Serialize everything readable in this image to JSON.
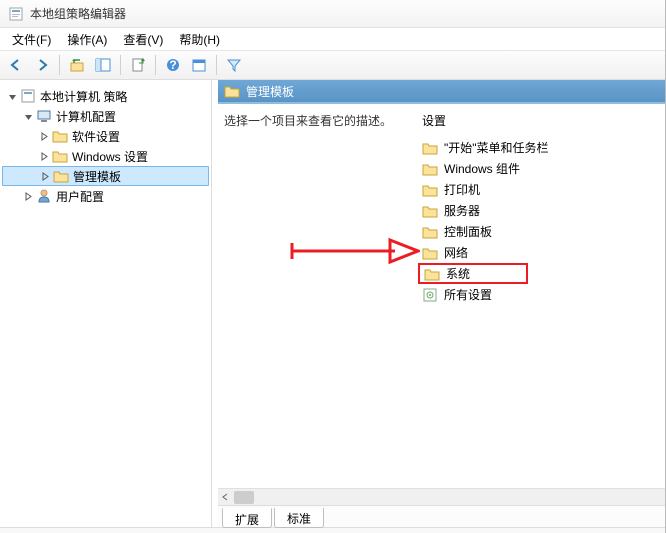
{
  "window": {
    "title": "本地组策略编辑器"
  },
  "menu": {
    "file": "文件(F)",
    "action": "操作(A)",
    "view": "查看(V)",
    "help": "帮助(H)"
  },
  "tree": {
    "root": "本地计算机 策略",
    "computer_config": "计算机配置",
    "software_settings": "软件设置",
    "windows_settings": "Windows 设置",
    "admin_templates": "管理模板",
    "user_config": "用户配置"
  },
  "right": {
    "header": "管理模板",
    "description": "选择一个项目来查看它的描述。",
    "column_header": "设置",
    "items": [
      "\"开始\"菜单和任务栏",
      "Windows 组件",
      "打印机",
      "服务器",
      "控制面板",
      "网络",
      "系统",
      "所有设置"
    ]
  },
  "tabs": {
    "extended": "扩展",
    "standard": "标准"
  }
}
